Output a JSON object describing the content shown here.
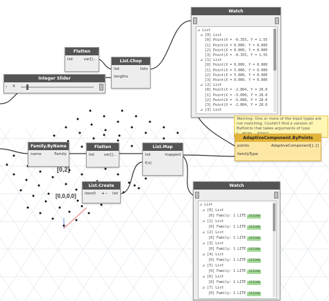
{
  "watch_top": {
    "title": "Watch",
    "lines": [
      "⊿ List",
      "⊿ [0] List",
      "[0] Point(X = -0.355, Y = 1.55",
      "[1] Point(X = 0.000, Y = 0.000",
      "[2] Point(X = 0.000, Y = 0.000",
      "[3] Point(X = -0.355, Y = 1.55",
      "⊿ [1] List",
      "[0] Point(X = 0.000, Y = 0.000",
      "[1] Point(X = 5.000, Y = 0.000",
      "[2] Point(X = 5.000, Y = 0.000",
      "[3] Point(X = 0.000, Y = 0.000",
      "⊿ [2] List",
      "[0] Point(X = -2.804, Y = 28.0",
      "[1] Point(X = -5.000, Y = 28.0",
      "[2] Point(X = -5.000, Y = 28.0",
      "[3] Point(X = -2.804, Y = 28.0",
      "⊿ [3] List"
    ]
  },
  "flatten_top": {
    "title": "Flatten",
    "in": "list",
    "out": "var[]..."
  },
  "integer_slider": {
    "title": "Integer Slider",
    "value": "4"
  },
  "list_chop": {
    "title": "List.Chop",
    "in1": "list",
    "in2": "lengths",
    "out": "lists"
  },
  "warning_text": "Warning: One or more of the input types are not matching. Couldn't find a version of ByPoints that takes arguments of type (__array,__array)",
  "adaptive": {
    "title": "AdaptiveComponent.ByPoints",
    "in1": "points",
    "in2": "familyType",
    "out": "AdaptiveComponent[]..[]"
  },
  "family_byname": {
    "title": "Family.ByName",
    "in": "name",
    "out": "Family"
  },
  "flatten_mid": {
    "title": "Flatten",
    "in": "list",
    "out": "var[]..."
  },
  "list_map": {
    "title": "List.Map",
    "in1": "list",
    "in2": "f(x)",
    "out": "mapped"
  },
  "list_create": {
    "title": "List.Create",
    "in": "item0",
    "plus": "+",
    "minus": "-",
    "out": "list"
  },
  "canvas_labels": {
    "vec": "[0,2]",
    "origin": "[0,0,0,0]"
  },
  "watch_bottom": {
    "title": "Watch",
    "lines": [
      {
        "t": "⊿ List",
        "b": ""
      },
      {
        "t": "⊿ [0] List",
        "b": ""
      },
      {
        "t": "[0] Family: 1 LITE",
        "b": "315180"
      },
      {
        "t": "⊿ [1] List",
        "b": ""
      },
      {
        "t": "[0] Family: 1 LITE",
        "b": "315180"
      },
      {
        "t": "⊿ [2] List",
        "b": ""
      },
      {
        "t": "[0] Family: 1 LITE",
        "b": "315180"
      },
      {
        "t": "⊿ [3] List",
        "b": ""
      },
      {
        "t": "[0] Family: 1 LITE",
        "b": "315180"
      },
      {
        "t": "⊿ [4] List",
        "b": ""
      },
      {
        "t": "[0] Family: 1 LITE",
        "b": "315180"
      },
      {
        "t": "⊿ [5] List",
        "b": ""
      },
      {
        "t": "[0] Family: 1 LITE",
        "b": "315180"
      },
      {
        "t": "⊿ [6] List",
        "b": ""
      },
      {
        "t": "[0] Family: 1 LITE",
        "b": "315180"
      },
      {
        "t": "⊿ [7] List",
        "b": ""
      },
      {
        "t": "[0] Family: 1 LITE",
        "b": "315180"
      }
    ]
  }
}
